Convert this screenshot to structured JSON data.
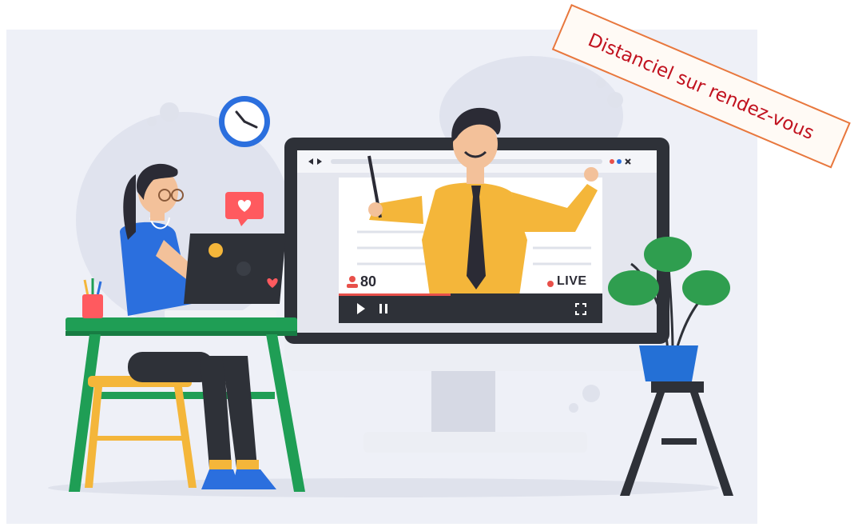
{
  "heading": {
    "text": ""
  },
  "stamp": {
    "text": "Distanciel sur rendez-vous"
  },
  "video": {
    "viewers": "80",
    "live_label": "LIVE"
  },
  "colors": {
    "accent_purple": "#6a2c8f",
    "stamp_text": "#c1121f",
    "stamp_border": "#e8773d",
    "desk_green": "#1f9e55",
    "shirt_yellow": "#f4b63a",
    "plant_green": "#2f9e4f",
    "pot_blue": "#2470d6"
  },
  "icons": [
    "clock-icon",
    "heart-icon",
    "viewer-person-icon",
    "live-dot-icon",
    "play-icon",
    "pause-icon",
    "fullscreen-icon",
    "browser-back-forward-icon",
    "browser-close-icon"
  ]
}
